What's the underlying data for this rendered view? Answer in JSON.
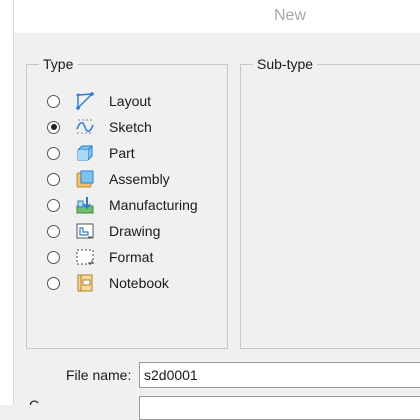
{
  "window": {
    "title": "New"
  },
  "type_group": {
    "legend": "Type",
    "options": [
      {
        "label": "Layout",
        "icon": "layout-icon",
        "selected": false
      },
      {
        "label": "Sketch",
        "icon": "sketch-icon",
        "selected": true
      },
      {
        "label": "Part",
        "icon": "part-icon",
        "selected": false
      },
      {
        "label": "Assembly",
        "icon": "assembly-icon",
        "selected": false
      },
      {
        "label": "Manufacturing",
        "icon": "manufacturing-icon",
        "selected": false
      },
      {
        "label": "Drawing",
        "icon": "drawing-icon",
        "selected": false
      },
      {
        "label": "Format",
        "icon": "format-icon",
        "selected": false
      },
      {
        "label": "Notebook",
        "icon": "notebook-icon",
        "selected": false
      }
    ]
  },
  "subtype_group": {
    "legend": "Sub-type"
  },
  "file_name": {
    "label": "File name:",
    "value": "s2d0001"
  },
  "common_name": {
    "label": "C",
    "value": ""
  },
  "colors": {
    "accent": "#2b7bd6",
    "icon_blue": "#5ab0e6"
  }
}
